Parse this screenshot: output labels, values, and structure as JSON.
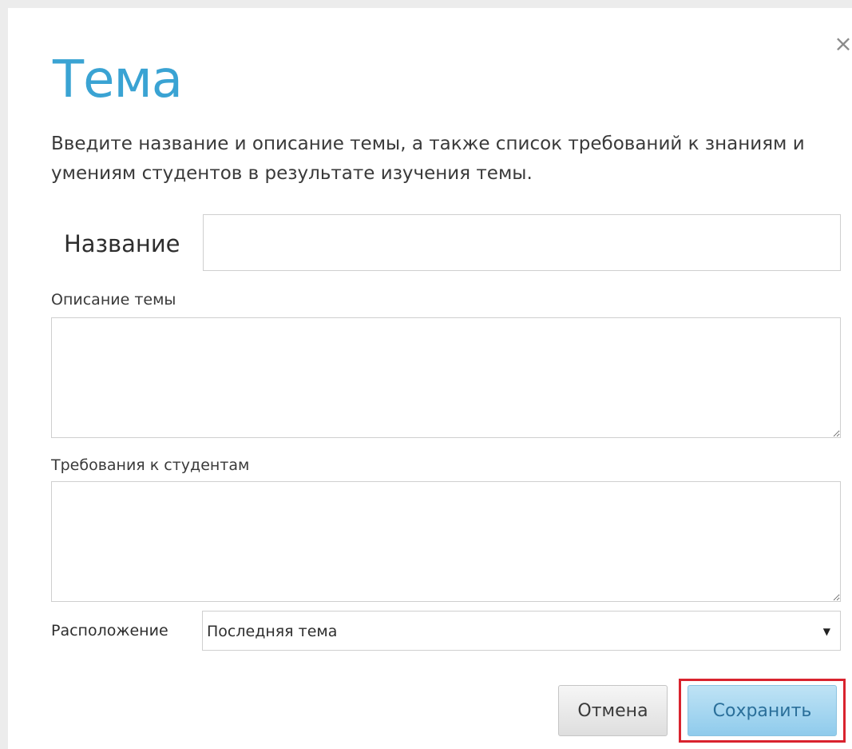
{
  "dialog": {
    "title": "Тема",
    "close_icon": "close-icon",
    "close_symbol": "×",
    "intro": "Введите название и описание темы, а также список требований к знаниям и умениям студентов в результате изучения темы."
  },
  "form": {
    "name_label": "Название",
    "name_value": "",
    "description_label": "Описание темы",
    "description_value": "",
    "requirements_label": "Требования к студентам",
    "requirements_value": "",
    "location_label": "Расположение",
    "location_selected": "Последняя тема",
    "caret_symbol": "▼"
  },
  "buttons": {
    "cancel_label": "Отмена",
    "save_label": "Сохранить"
  },
  "colors": {
    "title": "#3aa3d3",
    "save_button": "#8fcbec",
    "highlight_border": "#d9232e"
  }
}
